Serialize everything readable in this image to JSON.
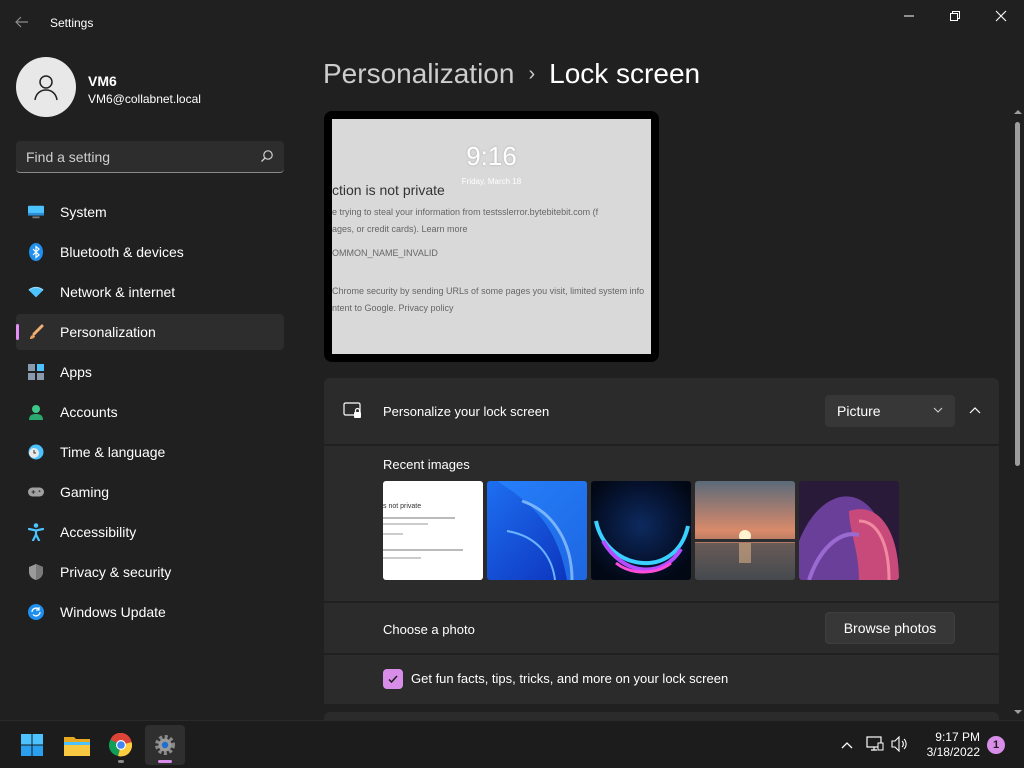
{
  "window": {
    "title": "Settings",
    "controls": [
      "minimize",
      "restore",
      "close"
    ]
  },
  "user": {
    "name": "VM6",
    "email": "VM6@collabnet.local"
  },
  "search": {
    "placeholder": "Find a setting"
  },
  "sidebar": {
    "items": [
      {
        "label": "System",
        "icon": "system-icon",
        "active": false
      },
      {
        "label": "Bluetooth & devices",
        "icon": "bluetooth-icon",
        "active": false
      },
      {
        "label": "Network & internet",
        "icon": "wifi-icon",
        "active": false
      },
      {
        "label": "Personalization",
        "icon": "paintbrush-icon",
        "active": true
      },
      {
        "label": "Apps",
        "icon": "apps-icon",
        "active": false
      },
      {
        "label": "Accounts",
        "icon": "accounts-icon",
        "active": false
      },
      {
        "label": "Time & language",
        "icon": "clock-globe-icon",
        "active": false
      },
      {
        "label": "Gaming",
        "icon": "gamepad-icon",
        "active": false
      },
      {
        "label": "Accessibility",
        "icon": "accessibility-icon",
        "active": false
      },
      {
        "label": "Privacy & security",
        "icon": "shield-icon",
        "active": false
      },
      {
        "label": "Windows Update",
        "icon": "update-icon",
        "active": false
      }
    ]
  },
  "breadcrumb": {
    "parent": "Personalization",
    "separator": "›",
    "current": "Lock screen"
  },
  "preview": {
    "time": "9:16",
    "date": "Friday, March 18",
    "lines": [
      "ction is not private",
      "e trying to steal your information from testsslerror.bytebitebit.com (f",
      "ages, or credit cards). Learn more",
      "OMMON_NAME_INVALID",
      "Chrome security by sending URLs of some pages you visit, limited system info",
      "ntent to Google. Privacy policy"
    ]
  },
  "personalize": {
    "label": "Personalize your lock screen",
    "dropdown_value": "Picture",
    "recent_label": "Recent images",
    "recent_images": [
      {
        "name": "browser-error-screenshot",
        "caption": "s not private"
      },
      {
        "name": "windows-bloom-blue"
      },
      {
        "name": "windows-glow-dark"
      },
      {
        "name": "lake-sunset"
      },
      {
        "name": "purple-ribbons"
      }
    ],
    "choose_photo_label": "Choose a photo",
    "browse_label": "Browse photos",
    "fun_facts_label": "Get fun facts, tips, tricks, and more on your lock screen",
    "fun_facts_checked": true
  },
  "taskbar": {
    "apps": [
      "start-icon",
      "file-explorer-icon",
      "chrome-icon",
      "settings-icon"
    ],
    "time": "9:17 PM",
    "date": "3/18/2022",
    "notification_count": "1"
  },
  "colors": {
    "accent": "#d88ee8",
    "background": "#202020",
    "card": "#2b2b2b"
  }
}
